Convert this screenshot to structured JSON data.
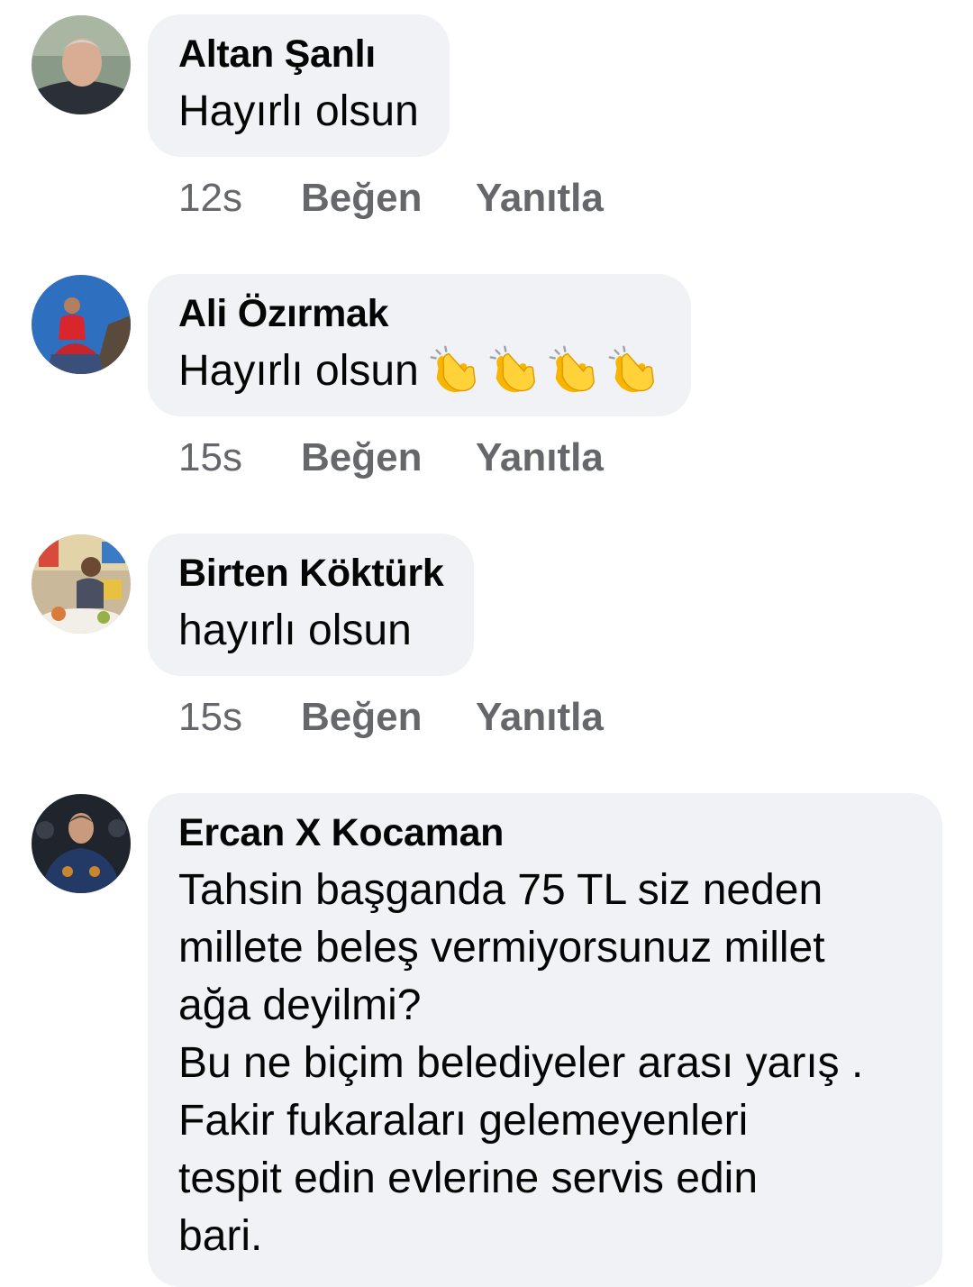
{
  "comments": [
    {
      "author": "Altan Şanlı",
      "lines": [
        "Hayırlı olsun"
      ],
      "time": "12s",
      "like_label": "Beğen",
      "reply_label": "Yanıtla"
    },
    {
      "author": "Ali Özırmak",
      "lines": [
        "Hayırlı olsun"
      ],
      "emoji": "clapping-hands-icon",
      "emoji_count": 4,
      "time": "15s",
      "like_label": "Beğen",
      "reply_label": "Yanıtla"
    },
    {
      "author": "Birten Köktürk",
      "lines": [
        "hayırlı olsun"
      ],
      "time": "15s",
      "like_label": "Beğen",
      "reply_label": "Yanıtla"
    },
    {
      "author": "Ercan X Kocaman",
      "lines": [
        "Tahsin başganda 75 TL siz neden",
        "millete beleş vermiyorsunuz millet",
        "ağa deyilmi?",
        "Bu ne biçim belediyeler arası yarış .",
        "Fakir fukaraları gelemeyenleri",
        "tespit edin evlerine servis edin",
        "bari."
      ]
    }
  ],
  "colors": {
    "bubble_bg": "#f0f2f5",
    "meta_text": "#65676b",
    "author_text": "#050505"
  }
}
